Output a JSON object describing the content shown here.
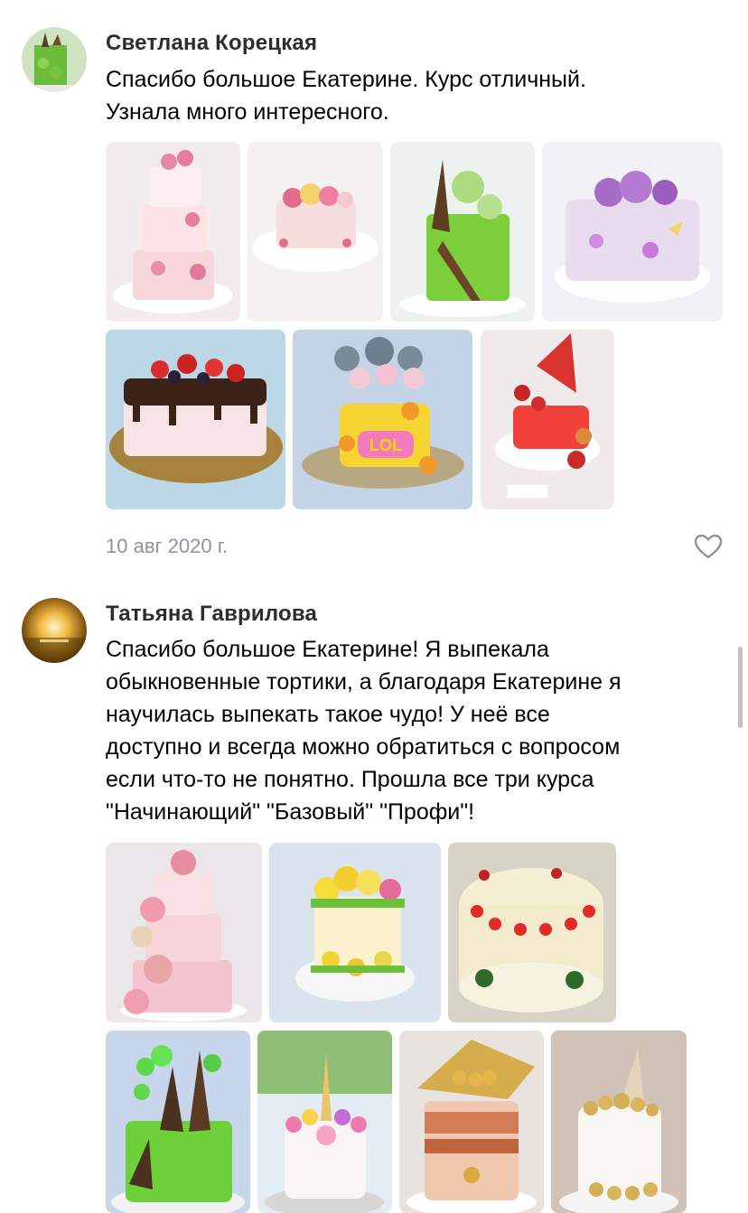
{
  "comments": [
    {
      "author": "Светлана Корецкая",
      "text_lines": [
        "Спасибо большое Екатерине. Курс отличный.",
        "Узнала много интересного."
      ],
      "photo_count": 7,
      "date": "10 авг 2020 г.",
      "like_icon": "heart-outline-icon"
    },
    {
      "author": "Татьяна Гаврилова",
      "text_lines": [
        "Спасибо большое Екатерине! Я выпекала",
        "обыкновенные тортики, а благодаря Екатерине я",
        "научилась выпекать такое чудо! У неё все",
        "доступно и всегда можно обратиться с вопросом",
        "если что-то не понятно. Прошла все три курса",
        "\"Начинающий\" \"Базовый\" \"Профи\"!"
      ],
      "photo_count": 7
    }
  ],
  "cake_toppers": {
    "lol_text": "LOL"
  },
  "colors": {
    "author": "#2c2d2e",
    "meta": "#909499",
    "scrollbar": "#bfc2c6"
  }
}
